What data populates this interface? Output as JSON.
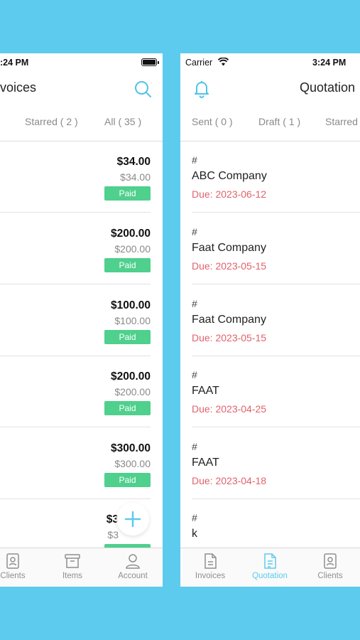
{
  "left": {
    "status_time": ":24 PM",
    "title": "voices",
    "tabs": [
      {
        "label": "Starred ( 2 )"
      },
      {
        "label": "All ( 35 )"
      }
    ],
    "invoices": [
      {
        "amount": "$34.00",
        "sub": "$34.00",
        "status": "Paid"
      },
      {
        "amount": "$200.00",
        "sub": "$200.00",
        "status": "Paid"
      },
      {
        "amount": "$100.00",
        "sub": "$100.00",
        "status": "Paid"
      },
      {
        "amount": "$200.00",
        "sub": "$200.00",
        "status": "Paid"
      },
      {
        "amount": "$300.00",
        "sub": "$300.00",
        "status": "Paid"
      },
      {
        "amount": "$3",
        "sub": "$3",
        "status": "Paid"
      }
    ],
    "tabbar": [
      {
        "label": "Clients",
        "icon": "clients-icon"
      },
      {
        "label": "Items",
        "icon": "items-icon"
      },
      {
        "label": "Account",
        "icon": "account-icon"
      }
    ]
  },
  "right": {
    "carrier": "Carrier",
    "status_time": "3:24 PM",
    "title": "Quotation",
    "tabs": [
      {
        "label": "Sent ( 0 )"
      },
      {
        "label": "Draft ( 1 )"
      },
      {
        "label": "Starred"
      }
    ],
    "quotations": [
      {
        "hash": "#",
        "name": "ABC Company",
        "due": "Due: 2023-06-12"
      },
      {
        "hash": "#",
        "name": "Faat Company",
        "due": "Due: 2023-05-15"
      },
      {
        "hash": "#",
        "name": "Faat Company",
        "due": "Due: 2023-05-15"
      },
      {
        "hash": "#",
        "name": "FAAT",
        "due": "Due: 2023-04-25"
      },
      {
        "hash": "#",
        "name": "FAAT",
        "due": "Due: 2023-04-18"
      },
      {
        "hash": "#",
        "name": "k",
        "due": ""
      }
    ],
    "tabbar": [
      {
        "label": "Invoices",
        "icon": "invoices-icon"
      },
      {
        "label": "Quotation",
        "icon": "quotation-icon"
      },
      {
        "label": "Clients",
        "icon": "clients-icon"
      }
    ]
  },
  "colors": {
    "background": "#5ccbee",
    "accent": "#5ccbee",
    "paid": "#4fd08d",
    "due": "#e0626c"
  }
}
